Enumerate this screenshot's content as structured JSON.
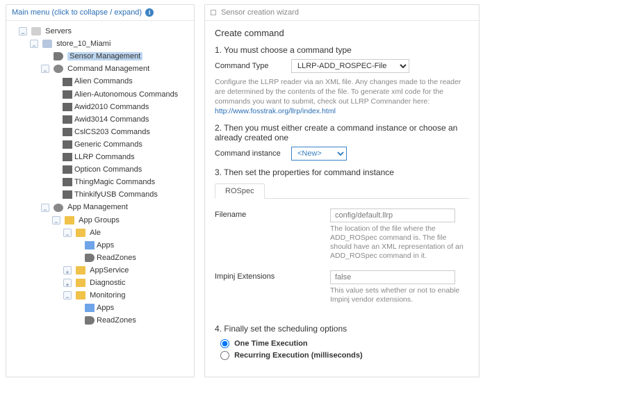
{
  "left": {
    "menuTitle": "Main menu (click to collapse / expand)",
    "tree": {
      "root": "Servers",
      "store": "store_10_Miami",
      "sensorMgmt": "Sensor Management",
      "cmdMgmt": "Command Management",
      "cmds": [
        "Alien Commands",
        "Alien-Autonomous Commands",
        "Awid2010 Commands",
        "Awid3014 Commands",
        "CslCS203 Commands",
        "Generic Commands",
        "LLRP Commands",
        "Opticon Commands",
        "ThingMagic Commands",
        "ThinkifyUSB Commands"
      ],
      "appMgmt": "App Management",
      "appGroups": "App Groups",
      "ale": "Ale",
      "aleApps": "Apps",
      "aleRead": "ReadZones",
      "appService": "AppService",
      "diagnostic": "Diagnostic",
      "monitoring": "Monitoring",
      "monApps": "Apps",
      "monRead": "ReadZones"
    }
  },
  "right": {
    "header": "Sensor creation wizard",
    "title": "Create command",
    "step1": "1. You must choose a command type",
    "cmdTypeLabel": "Command Type",
    "cmdTypeValue": "LLRP-ADD_ROSPEC-File",
    "cmdTypeHint1": "Configure the LLRP reader via an XML file. Any changes made to the reader are determined by the contents of the file. To generate xml code for the commands you want to submit, check out LLRP Commander here: ",
    "cmdTypeHintLink": "http://www.fosstrak.org/llrp/index.html",
    "step2": "2. Then you must either create a command instance or choose an already created one",
    "cmdInstLabel": "Command instance",
    "cmdInstValue": "<New>",
    "step3": "3. Then set the properties for command instance",
    "tab": "ROSpec",
    "prop1Label": "Filename",
    "prop1Value": "config/default.llrp",
    "prop1Hint": "The location of the file where the ADD_ROSpec command is. The file should have an XML representation of an ADD_ROSpec command in it.",
    "prop2Label": "Impinj Extensions",
    "prop2Value": "false",
    "prop2Hint": "This value sets whether or not to enable Impinj vendor extensions.",
    "step4": "4. Finally set the scheduling options",
    "schedOpt1": "One Time Execution",
    "schedOpt2": "Recurring Execution (milliseconds)"
  }
}
